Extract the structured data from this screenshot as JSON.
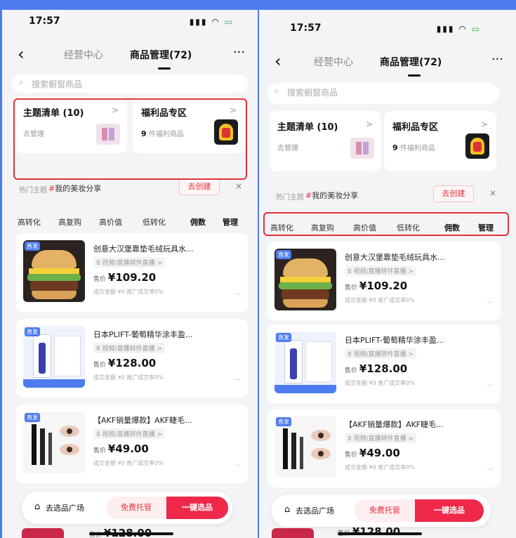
{
  "colors": {
    "accent_blue": "#4d7cf0",
    "highlight_red": "#e0333b",
    "primary_pink": "#f0284a"
  },
  "status": {
    "time": "17:57"
  },
  "nav": {
    "back_icon": "chevron-left-icon",
    "tab1": "经营中心",
    "tab2": "商品管理(72)",
    "more": "···"
  },
  "search": {
    "placeholder": "搜索橱窗商品"
  },
  "cards": {
    "theme": {
      "title": "主题清单 (10)",
      "sub": "去管理",
      "chev": ">"
    },
    "welfare": {
      "title": "福利品专区",
      "sub_count": "9",
      "sub": "件福利商品",
      "chev": ">"
    }
  },
  "topic": {
    "label": "热门主题",
    "hash": "#",
    "value": "我的美妆分享",
    "create": "去创建",
    "close": "×"
  },
  "filters": [
    "高转化",
    "高复购",
    "高价值",
    "低转化",
    "佣数",
    "管理"
  ],
  "items": [
    {
      "tag": "直发",
      "title": "创意大汉堡靠垫毛绒玩具水...",
      "badge": "8 视频/直播转件直播 >",
      "price_label": "售价",
      "price": "¥109.20",
      "meta": "成交金额 ¥0  推广成交率0%"
    },
    {
      "tag": "直发",
      "title": "日本PLIFT-葡萄精华涂丰盈...",
      "badge": "8 视频/直播转件直播 >",
      "price_label": "售价",
      "price": "¥128.00",
      "meta": "成交金额 ¥0  推广成交率0%"
    },
    {
      "tag": "直发",
      "title": "【AKF销量爆款】AKF睫毛...",
      "badge": "8 视频/直播转件直播 >",
      "price_label": "售价",
      "price": "¥49.00",
      "meta": "成交金额 ¥0  推广成交率0%"
    }
  ],
  "bottombar": {
    "icon": "bag-icon",
    "plaza": "去选品广场",
    "free": "免费托管",
    "onekey": "一键选品"
  },
  "peek": {
    "price_label": "售价",
    "price": "¥128.00"
  }
}
